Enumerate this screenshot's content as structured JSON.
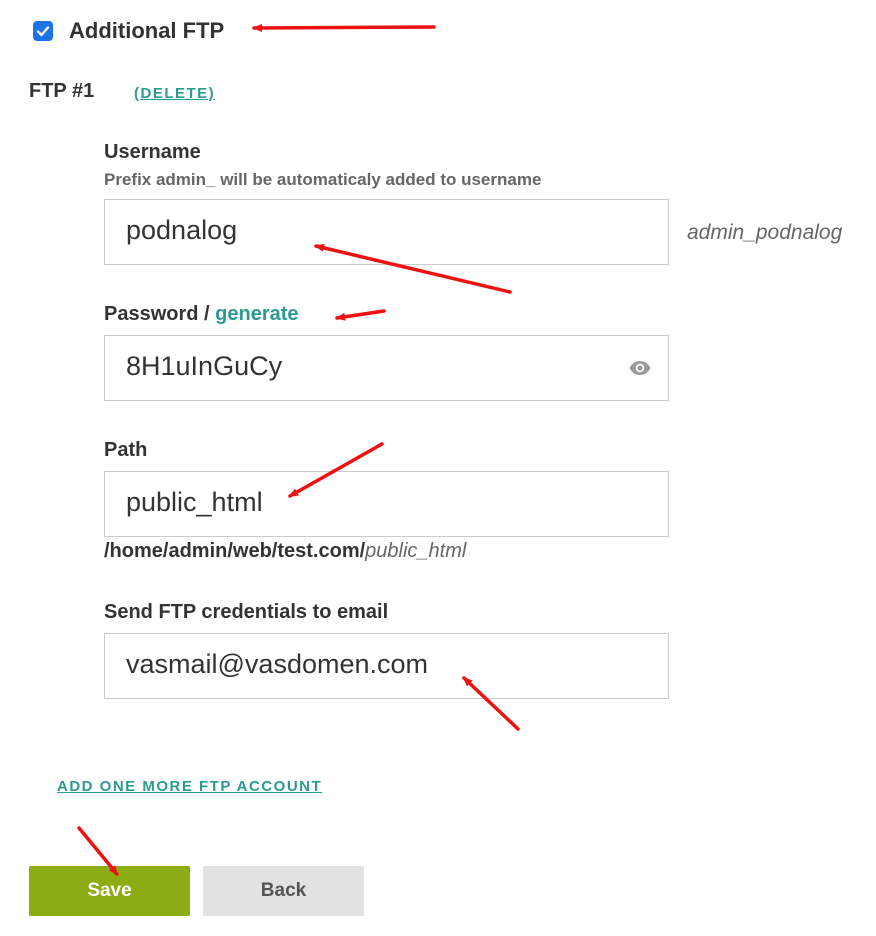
{
  "additional_ftp": {
    "checked": true,
    "label": "Additional FTP"
  },
  "ftp_account": {
    "title": "FTP #1",
    "delete_label": "(DELETE)"
  },
  "username": {
    "label": "Username",
    "hint": "Prefix admin_ will be automaticaly added to username",
    "value": "podnalog",
    "full_name": "admin_podnalog"
  },
  "password": {
    "label": "Password",
    "separator": " / ",
    "generate_label": "generate",
    "value": "8H1uInGuCy",
    "toggle_icon": "eye-icon"
  },
  "path": {
    "label": "Path",
    "value": "public_html",
    "base_path": "/home/admin/web/test.com/",
    "suffix": "public_html"
  },
  "email": {
    "label": "Send FTP credentials to email",
    "value": "vasmail@vasdomen.com"
  },
  "add_more_label": "ADD ONE MORE FTP ACCOUNT",
  "buttons": {
    "save": "Save",
    "back": "Back"
  },
  "colors": {
    "accent": "#2d9a92",
    "save_bg": "#8bac12",
    "back_bg": "#e2e2e2",
    "checkbox": "#1a73e8",
    "annotation_arrow": "#ee1111"
  }
}
